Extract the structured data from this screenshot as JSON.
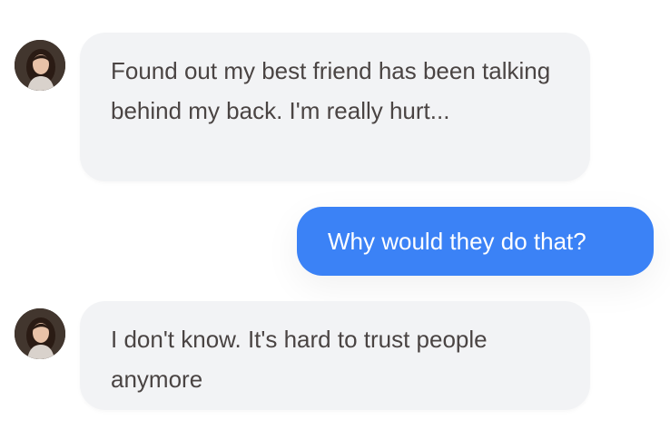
{
  "chat": {
    "messages": [
      {
        "sender": "contact",
        "avatar_icon": "user-avatar-icon",
        "text": "Found out my best friend has been talking behind my back. I'm really hurt..."
      },
      {
        "sender": "self",
        "text": "Why would they do that?"
      },
      {
        "sender": "contact",
        "avatar_icon": "user-avatar-icon",
        "text": "I don't know. It's hard to trust people anymore"
      }
    ]
  },
  "colors": {
    "incoming_bubble": "#f2f3f5",
    "incoming_text": "#4a4443",
    "outgoing_bubble": "#3b82f6",
    "outgoing_text": "#ffffff"
  }
}
